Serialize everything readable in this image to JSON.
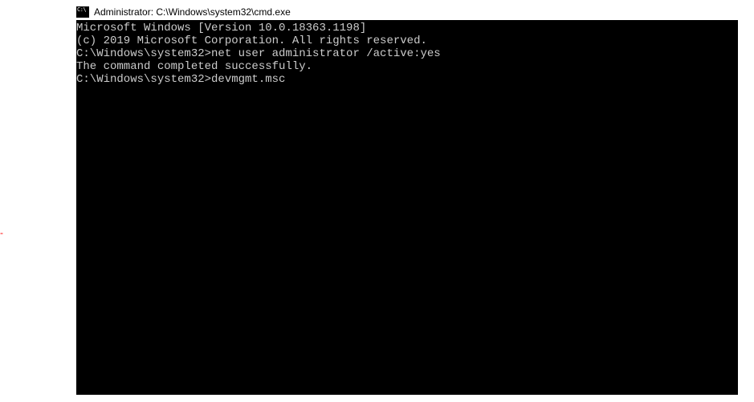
{
  "titlebar": {
    "text": "Administrator: C:\\Windows\\system32\\cmd.exe"
  },
  "terminal": {
    "lines": [
      "Microsoft Windows [Version 10.0.18363.1198]",
      "(c) 2019 Microsoft Corporation. All rights reserved.",
      "",
      "C:\\Windows\\system32>net user administrator /active:yes",
      "The command completed successfully.",
      "",
      "",
      "C:\\Windows\\system32>devmgmt.msc"
    ]
  },
  "decoration": {
    "red_dash": "-"
  }
}
